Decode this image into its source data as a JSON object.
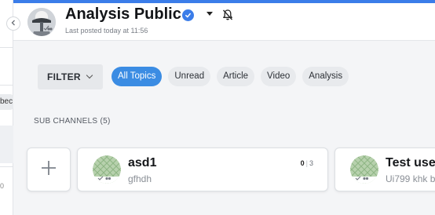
{
  "header": {
    "title": "Analysis Public",
    "subtitle": "Last posted today at 11:56"
  },
  "filter": {
    "label": "FILTER",
    "chips": [
      "All Topics",
      "Unread",
      "Article",
      "Video",
      "Analysis"
    ],
    "active_chip": "All Topics"
  },
  "subchannels": {
    "label": "SUB CHANNELS (5)",
    "cards": [
      {
        "name": "asd1",
        "description": "gfhdh",
        "count_unread": "0",
        "count_total": "3"
      },
      {
        "name": "Test use",
        "description": "Ui799 khk b"
      }
    ]
  },
  "left_panel": {
    "snippet": "bec",
    "number": "0"
  },
  "colors": {
    "accent": "#3b7de9",
    "chip_active": "#3b8ce3",
    "thumbnail": "#a8c6a0"
  },
  "icons": {
    "collapse": "chevron-left-icon",
    "verified": "check-badge-icon",
    "dropdown": "caret-down-icon",
    "mute": "bell-off-icon",
    "add": "plus-icon"
  }
}
